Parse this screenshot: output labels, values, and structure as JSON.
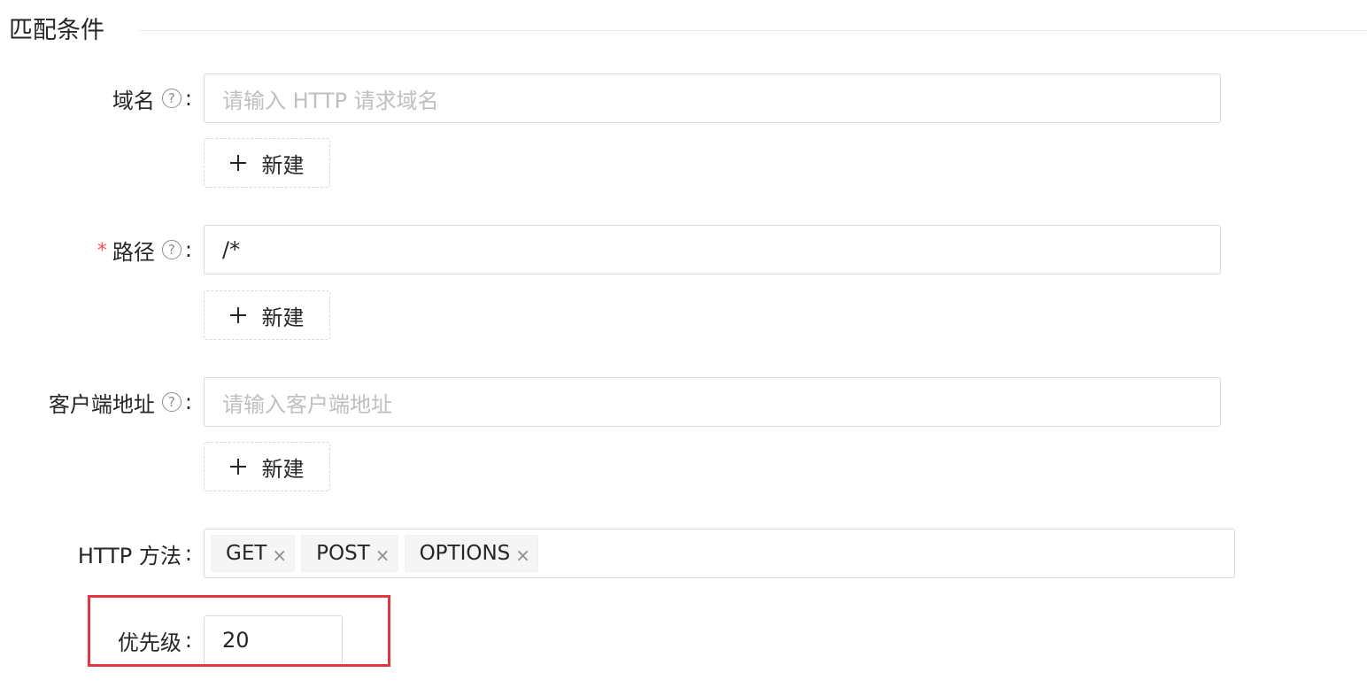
{
  "section": {
    "title": "匹配条件"
  },
  "domain_field": {
    "label": "域名",
    "help_icon": "question-circle-icon",
    "colon": ":",
    "placeholder": "请输入 HTTP 请求域名",
    "add_label": "新建"
  },
  "path_field": {
    "required_mark": "*",
    "label": "路径",
    "help_icon": "question-circle-icon",
    "colon": ":",
    "value": "/*",
    "add_label": "新建"
  },
  "client_field": {
    "label": "客户端地址",
    "help_icon": "question-circle-icon",
    "colon": ":",
    "placeholder": "请输入客户端地址",
    "add_label": "新建"
  },
  "http_methods": {
    "label": "HTTP 方法",
    "colon": ":",
    "tags": [
      {
        "label": "GET",
        "close": "×"
      },
      {
        "label": "POST",
        "close": "×"
      },
      {
        "label": "OPTIONS",
        "close": "×"
      }
    ]
  },
  "priority_field": {
    "label": "优先级",
    "colon": ":",
    "value": "20"
  },
  "colors": {
    "required": "#ff4d4f",
    "highlight": "#e3363d",
    "border": "#d9d9d9",
    "placeholder": "#bfbfbf",
    "tag_bg": "#f5f5f5"
  }
}
